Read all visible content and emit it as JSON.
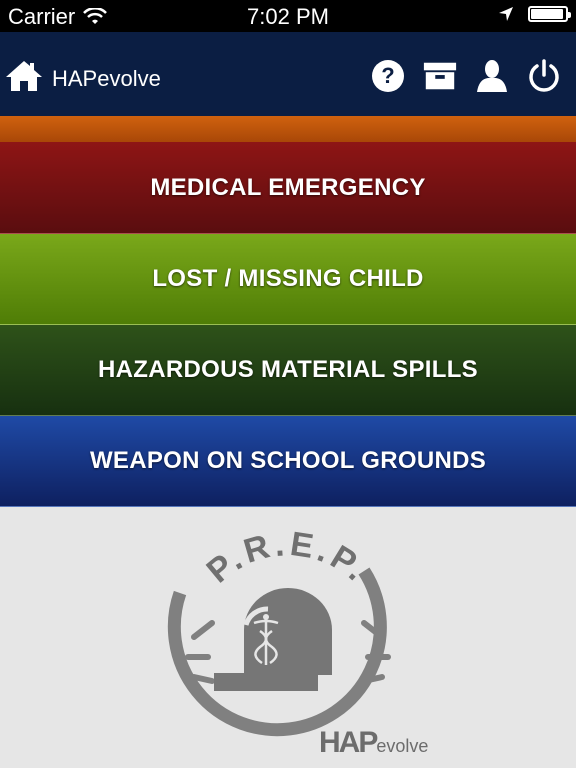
{
  "status_bar": {
    "carrier": "Carrier",
    "time": "7:02 PM",
    "battery_level": 0.95
  },
  "navbar": {
    "title": "HAPevolve",
    "icons": [
      "home-icon",
      "help-icon",
      "archive-icon",
      "user-icon",
      "power-icon"
    ]
  },
  "menu": {
    "items": [
      {
        "label": "MEDICAL EMERGENCY"
      },
      {
        "label": "LOST / MISSING CHILD"
      },
      {
        "label": "HAZARDOUS MATERIAL SPILLS"
      },
      {
        "label": "WEAPON ON SCHOOL GROUNDS"
      }
    ]
  },
  "logo": {
    "prep_text": "P.R.E.P.",
    "brand_hap": "HAP",
    "brand_evolve": "evolve"
  },
  "colors": {
    "navbar": "#0b1e43",
    "orange": "#c2570c",
    "medical": "#7a1214",
    "lost": "#6a9b10",
    "hazard": "#213f14",
    "weapon": "#17358a",
    "logo_gray": "#777777"
  }
}
